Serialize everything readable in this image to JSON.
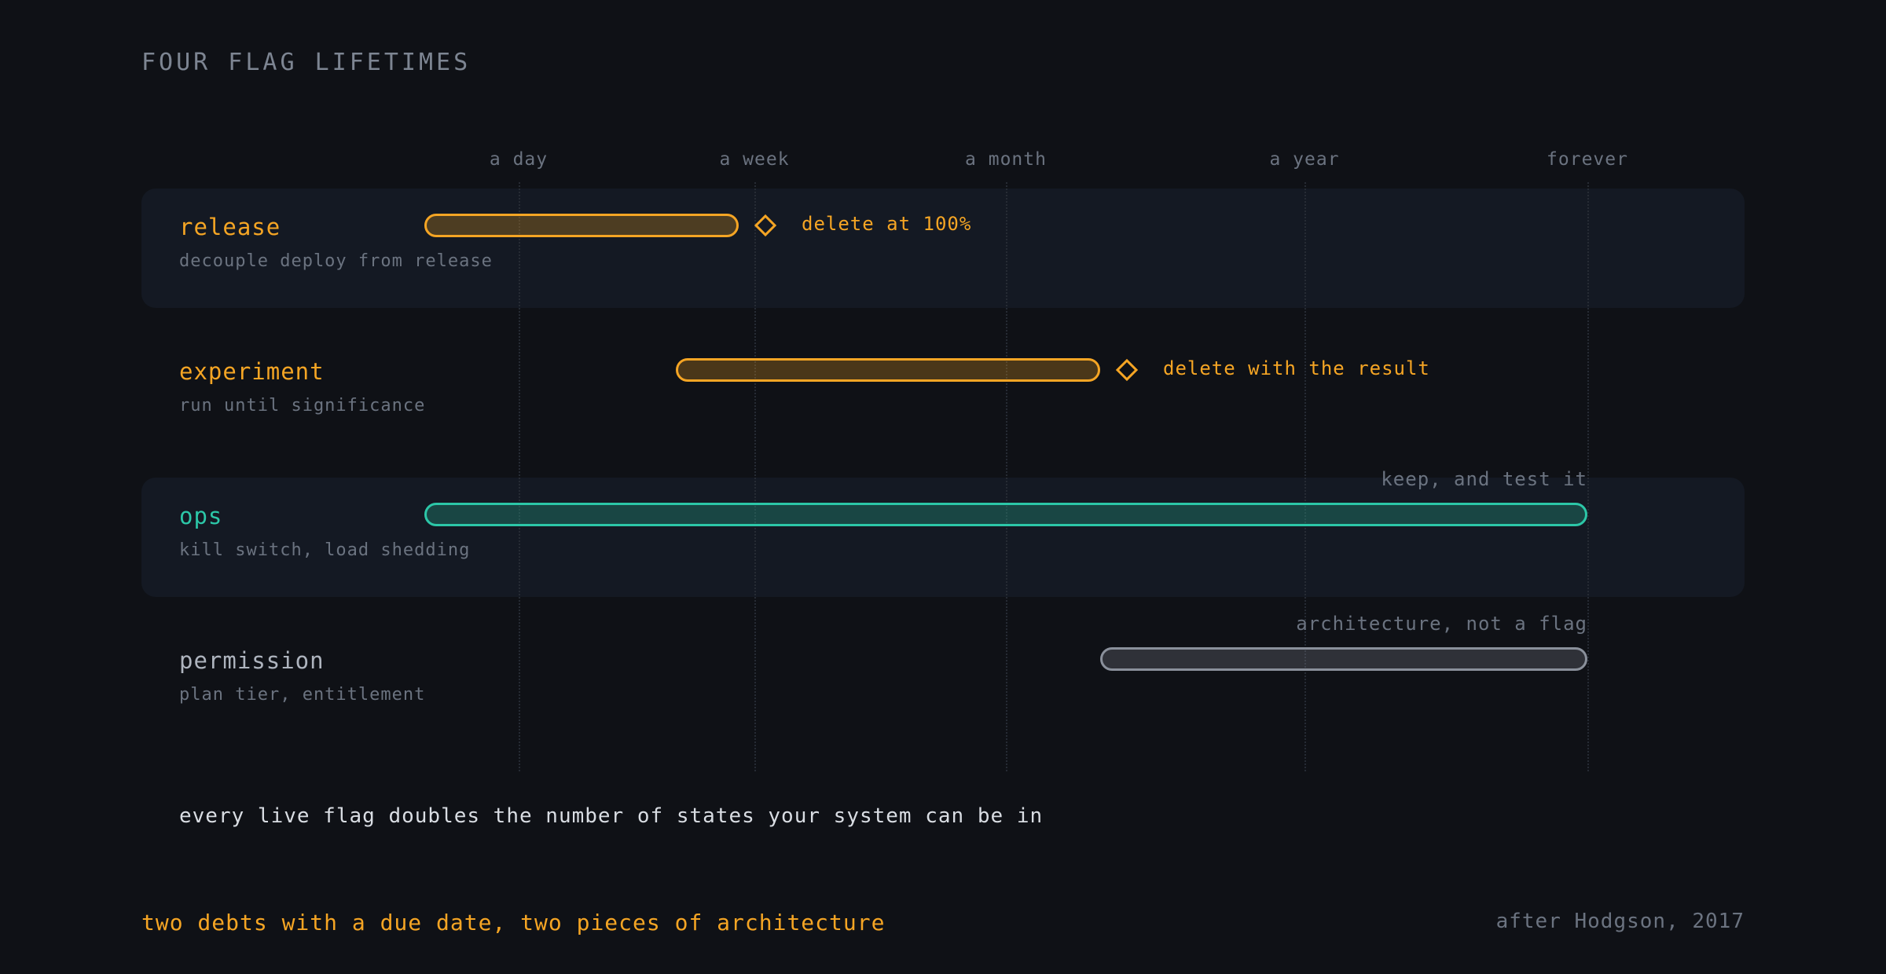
{
  "chart_data": {
    "type": "range-bar",
    "title": "FOUR FLAG LIFETIMES",
    "axis": {
      "scale": "ordinal",
      "ticks": [
        "a day",
        "a week",
        "a month",
        "a year",
        "forever"
      ]
    },
    "colors": {
      "amber": "#f5a524",
      "teal": "#2cc7a8",
      "gray": "#8a909b"
    },
    "rows": [
      {
        "name": "release",
        "subtitle": "decouple deploy from release",
        "start": "hours",
        "end": "about a week",
        "color": "#f5a524",
        "end_marker": "diamond",
        "annotation": "delete at 100%",
        "band": true
      },
      {
        "name": "experiment",
        "subtitle": "run until significance",
        "start": "days",
        "end": "about a quarter",
        "color": "#f5a524",
        "end_marker": "diamond",
        "annotation": "delete with the result",
        "band": false
      },
      {
        "name": "ops",
        "subtitle": "kill switch, load shedding",
        "start": "hours",
        "end": "forever",
        "color": "#2cc7a8",
        "end_marker": "none",
        "annotation": "keep, and test it",
        "band": true
      },
      {
        "name": "permission",
        "subtitle": "plan tier, entitlement",
        "start": "about a quarter",
        "end": "forever",
        "color": "#8a909b",
        "end_marker": "none",
        "annotation": "architecture, not a flag",
        "band": false
      }
    ],
    "statement": "every live flag doubles the number of states your system can be in",
    "conclusion": "two debts with a due date, two pieces of architecture",
    "credit": "after Hodgson, 2017"
  }
}
